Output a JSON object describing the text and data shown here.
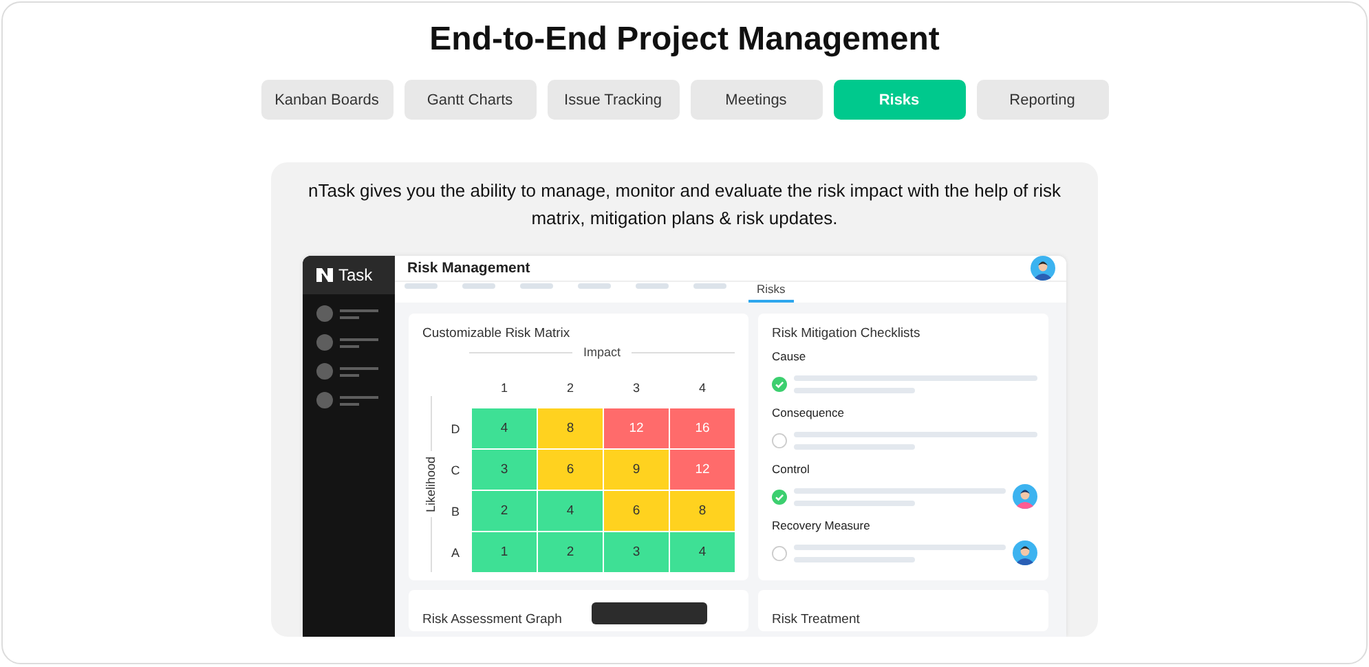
{
  "title": "End-to-End Project Management",
  "tabs": [
    {
      "label": "Kanban Boards",
      "selected": false
    },
    {
      "label": "Gantt Charts",
      "selected": false
    },
    {
      "label": "Issue Tracking",
      "selected": false
    },
    {
      "label": "Meetings",
      "selected": false
    },
    {
      "label": "Risks",
      "selected": true
    },
    {
      "label": "Reporting",
      "selected": false
    }
  ],
  "description": "nTask gives you the ability to manage, monitor and evaluate the risk impact with the help of risk matrix, mitigation plans & risk updates.",
  "app": {
    "logo_text": "Task",
    "header_title": "Risk Management",
    "subtab": "Risks",
    "matrix": {
      "title": "Customizable Risk Matrix",
      "x_axis": "Impact",
      "y_axis": "Likelihood",
      "columns": [
        "1",
        "2",
        "3",
        "4"
      ],
      "rows": [
        {
          "label": "D",
          "cells": [
            {
              "value": "4",
              "color": "#3ee095"
            },
            {
              "value": "8",
              "color": "#ffd21f"
            },
            {
              "value": "12",
              "color": "#ff6b6b"
            },
            {
              "value": "16",
              "color": "#ff6b6b"
            }
          ]
        },
        {
          "label": "C",
          "cells": [
            {
              "value": "3",
              "color": "#3ee095"
            },
            {
              "value": "6",
              "color": "#ffd21f"
            },
            {
              "value": "9",
              "color": "#ffd21f"
            },
            {
              "value": "12",
              "color": "#ff6b6b"
            }
          ]
        },
        {
          "label": "B",
          "cells": [
            {
              "value": "2",
              "color": "#3ee095"
            },
            {
              "value": "4",
              "color": "#3ee095"
            },
            {
              "value": "6",
              "color": "#ffd21f"
            },
            {
              "value": "8",
              "color": "#ffd21f"
            }
          ]
        },
        {
          "label": "A",
          "cells": [
            {
              "value": "1",
              "color": "#3ee095"
            },
            {
              "value": "2",
              "color": "#3ee095"
            },
            {
              "value": "3",
              "color": "#3ee095"
            },
            {
              "value": "4",
              "color": "#3ee095"
            }
          ]
        }
      ]
    },
    "checklist": {
      "title": "Risk Mitigation Checklists",
      "items": [
        {
          "label": "Cause",
          "checked": true,
          "kind": "plain"
        },
        {
          "label": "Consequence",
          "checked": false,
          "kind": "plain"
        },
        {
          "label": "Control",
          "checked": true,
          "kind": "assigned"
        },
        {
          "label": "Recovery Measure",
          "checked": false,
          "kind": "assigned"
        }
      ]
    },
    "bottom_cards": [
      "Risk Assessment Graph",
      "Risk Treatment"
    ]
  }
}
